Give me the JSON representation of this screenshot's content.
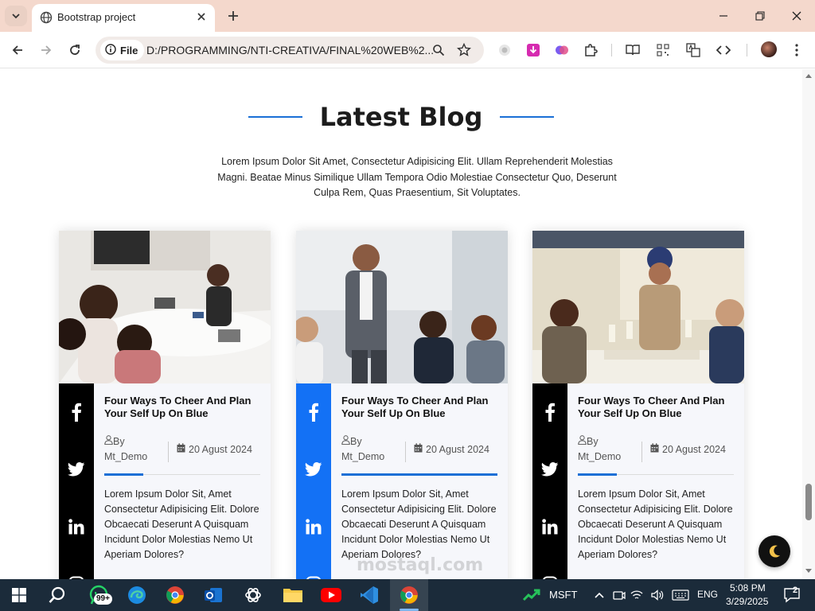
{
  "browser": {
    "tab_title": "Bootstrap project",
    "site_chip": "File",
    "url": "D:/PROGRAMMING/NTI-CREATIVA/FINAL%20WEB%2..."
  },
  "section": {
    "title": "Latest Blog",
    "description": "Lorem Ipsum Dolor Sit Amet, Consectetur Adipisicing Elit. Ullam Reprehenderit Molestias Magni. Beatae Minus Similique Ullam Tempora Odio Molestiae Consectetur Quo, Deserunt Culpa Rem, Quas Praesentium, Sit Voluptates."
  },
  "cards": [
    {
      "title": "Four Ways To Cheer And Plan Your Self Up On Blue",
      "author": "By Mt_Demo",
      "date": "20 Agust 2024",
      "text": "Lorem Ipsum Dolor Sit, Amet Consectetur Adipisicing Elit. Dolore Obcaecati Deserunt A Quisquam Incidunt Dolor Molestias Nemo Ut Aperiam Dolores?",
      "social_bg": "#000000",
      "accent_fraction": 0.25,
      "image_subject": "team-meeting-at-table"
    },
    {
      "title": "Four Ways To Cheer And Plan Your Self Up On Blue",
      "author": "By Mt_Demo",
      "date": "20 Agust 2024",
      "text": "Lorem Ipsum Dolor Sit, Amet Consectetur Adipisicing Elit. Dolore Obcaecati Deserunt A Quisquam Incidunt Dolor Molestias Nemo Ut Aperiam Dolores?",
      "social_bg": "#1371f5",
      "accent_fraction": 1.0,
      "image_subject": "presenter-in-office"
    },
    {
      "title": "Four Ways To Cheer And Plan Your Self Up On Blue",
      "author": "By Mt_Demo",
      "date": "20 Agust 2024",
      "text": "Lorem Ipsum Dolor Sit, Amet Consectetur Adipisicing Elit. Dolore Obcaecati Deserunt A Quisquam Incidunt Dolor Molestias Nemo Ut Aperiam Dolores?",
      "social_bg": "#000000",
      "accent_fraction": 0.25,
      "image_subject": "toast-celebration"
    }
  ],
  "social_icons": [
    "facebook-icon",
    "twitter-icon",
    "linkedin-icon",
    "instagram-icon"
  ],
  "colors": {
    "accent": "#1a6fd6",
    "social_active": "#1371f5",
    "tabbar": "#f4d8cc"
  },
  "taskbar": {
    "whatsapp_badge": "99+",
    "stock_ticker": "MSFT",
    "language": "ENG",
    "time": "5:08 PM",
    "date": "3/29/2025",
    "notifications": "2"
  },
  "watermark": "mostaql.com"
}
